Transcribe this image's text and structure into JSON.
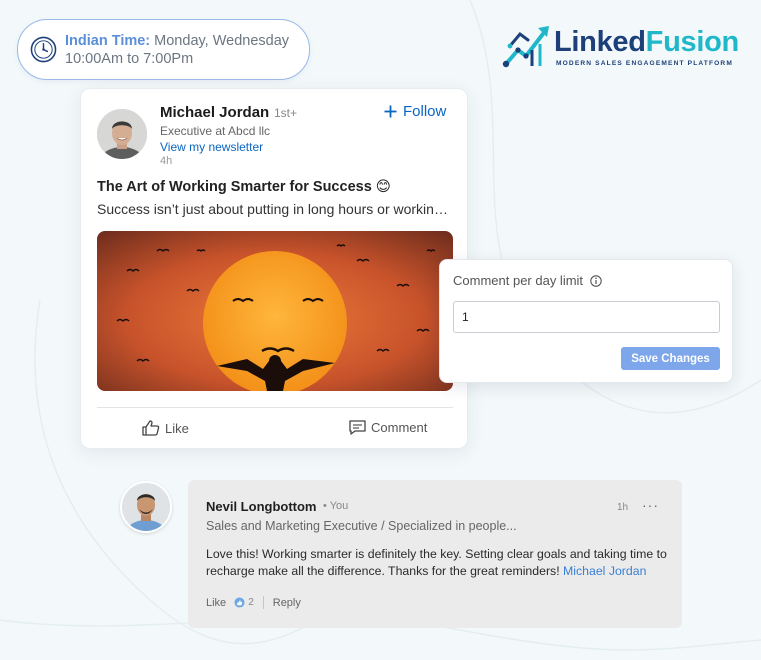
{
  "time_pill": {
    "label": "Indian Time:",
    "days": " Monday, Wednesday",
    "hours": "10:00Am to 7:00Pm"
  },
  "logo": {
    "word_part1": "Linked",
    "word_part2": "Fusion",
    "tagline": "MODERN SALES ENGAGEMENT PLATFORM"
  },
  "post": {
    "author_name": "Michael Jordan",
    "author_degree": "1st+",
    "author_title": "Executive at Abcd llc",
    "newsletter_link": "View my newsletter",
    "age": "4h",
    "follow_label": "Follow",
    "title": "The Art of Working Smarter for Success 😊",
    "body": "Success isn’t just about putting in long hours or working harder",
    "like_label": "Like",
    "comment_label": "Comment"
  },
  "limit_card": {
    "label": "Comment per day limit",
    "input_value": "1",
    "save_label": "Save Changes"
  },
  "reply": {
    "name": "Nevil Longbottom",
    "you_badge": "• You",
    "time": "1h",
    "more": "···",
    "title": "Sales and Marketing Executive / Specialized in people...",
    "text": "Love this! Working smarter is definitely the key. Setting clear goals and taking time to recharge make all the difference. Thanks for the great reminders! ",
    "mention": "Michael Jordan",
    "like_label": "Like",
    "reaction_count": "2",
    "reply_label": "Reply"
  },
  "colors": {
    "accent_blue": "#0a66c2",
    "pill_border": "#9bb8e8",
    "save_button": "#7ea6ea",
    "logo_navy": "#1d3f7a",
    "logo_teal": "#1fb7c9"
  },
  "icons": [
    "clock-icon",
    "plus-icon",
    "thumbs-up-icon",
    "comment-icon",
    "info-icon",
    "reaction-icon"
  ]
}
